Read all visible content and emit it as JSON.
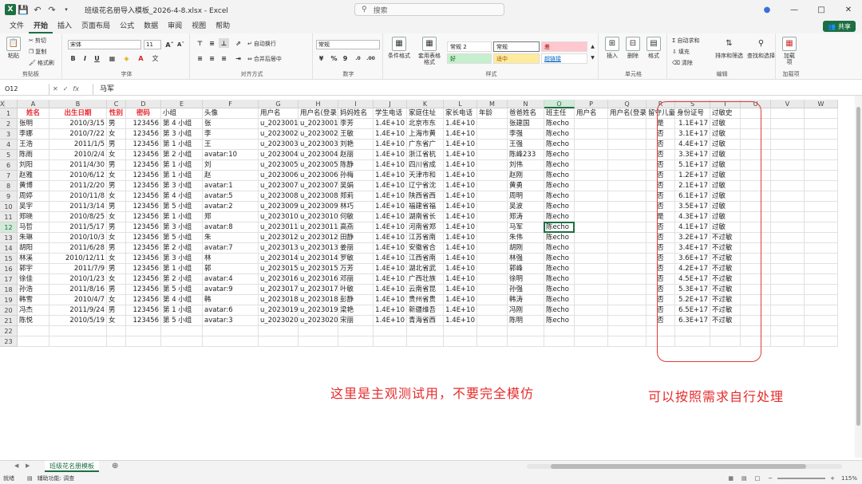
{
  "titlebar": {
    "filename": "班级花名册导入模板_2026-4-8.xlsx",
    "app": "Excel",
    "search_placeholder": "搜索"
  },
  "menu": [
    "文件",
    "开始",
    "插入",
    "页面布局",
    "公式",
    "数据",
    "审阅",
    "视图",
    "帮助"
  ],
  "menu_active": 1,
  "share_label": "共享",
  "ribbon": {
    "clipboard": {
      "paste": "粘贴",
      "cut": "剪切",
      "copy": "复制",
      "format_painter": "格式刷",
      "label": "剪贴板"
    },
    "font": {
      "name": "宋体",
      "size": "11",
      "label": "字体"
    },
    "alignment": {
      "wrap": "自动换行",
      "merge": "合并后居中",
      "label": "对齐方式"
    },
    "number": {
      "format": "常规",
      "label": "数字"
    },
    "styles": {
      "cond_format": "条件格式",
      "table_format": "套用表格格式",
      "normal2": "常规 2",
      "normal": "常规",
      "bad": "差",
      "good": "好",
      "neutral": "适中",
      "hyperlink": "超链接",
      "label": "样式"
    },
    "cells": {
      "insert": "插入",
      "delete": "删除",
      "format": "格式",
      "label": "单元格"
    },
    "editing": {
      "autosum": "自动求和",
      "fill": "填充",
      "clear": "清除",
      "sort": "排序和筛选",
      "find": "查找和选择",
      "label": "编辑"
    },
    "addins": {
      "addin": "加载项",
      "label": "加载项"
    }
  },
  "formula_bar": {
    "name_box": "O12",
    "value": "马军"
  },
  "columns": [
    "A",
    "B",
    "C",
    "D",
    "E",
    "F",
    "G",
    "H",
    "I",
    "J",
    "K",
    "L",
    "M",
    "N",
    "O",
    "P",
    "Q",
    "R",
    "S",
    "T",
    "U",
    "V",
    "W",
    "X"
  ],
  "selected_column": "O",
  "selected_row": 12,
  "row_count": 23,
  "rows": [
    [
      "",
      "姓名",
      "出生日期",
      "性别",
      "密码",
      "小组",
      "头像",
      "用户名",
      "用户名(登录)",
      "妈妈姓名",
      "学生电话",
      "家庭住址",
      "家长电话",
      "年龄",
      "爸爸姓名",
      "班主任",
      "用户名",
      "用户名(登录)",
      "留守儿童",
      "身份证号",
      "过敏史",
      "",
      "",
      ""
    ],
    [
      "",
      "张明",
      "2010/3/15",
      "男",
      "123456",
      "第 4 小组",
      "张",
      "u_2023001",
      "u_2023001",
      "李芳",
      "1.4E+10",
      "北京市东",
      "1.4E+10",
      "",
      "张建国",
      "陈echo",
      "",
      "",
      "是",
      "1.1E+17",
      "过敏",
      "",
      "",
      ""
    ],
    [
      "",
      "李娜",
      "2010/7/22",
      "女",
      "123456",
      "第 3 小组",
      "李",
      "u_2023002",
      "u_2023002",
      "王敏",
      "1.4E+10",
      "上海市黄",
      "1.4E+10",
      "",
      "李强",
      "陈echo",
      "",
      "",
      "否",
      "3.1E+17",
      "过敏",
      "",
      "",
      ""
    ],
    [
      "",
      "王浩",
      "2011/1/5",
      "男",
      "123456",
      "第 1 小组",
      "王",
      "u_2023003",
      "u_2023003",
      "刘艳",
      "1.4E+10",
      "广东省广",
      "1.4E+10",
      "",
      "王强",
      "陈echo",
      "",
      "",
      "否",
      "4.4E+17",
      "过敏",
      "",
      "",
      ""
    ],
    [
      "",
      "陈雨",
      "2010/2/4",
      "女",
      "123456",
      "第 2 小组",
      "avatar:10",
      "u_2023004",
      "u_2023004",
      "赵丽",
      "1.4E+10",
      "浙江省杭",
      "1.4E+10",
      "",
      "陈峰233",
      "陈echo",
      "",
      "",
      "否",
      "3.3E+17",
      "过敏",
      "",
      "",
      ""
    ],
    [
      "",
      "刘阳",
      "2011/4/30",
      "男",
      "123456",
      "第 1 小组",
      "刘",
      "u_2023005",
      "u_2023005",
      "陈静",
      "1.4E+10",
      "四川省成",
      "1.4E+10",
      "",
      "刘伟",
      "陈echo",
      "",
      "",
      "否",
      "5.1E+17",
      "过敏",
      "",
      "",
      ""
    ],
    [
      "",
      "赵雅",
      "2010/6/12",
      "女",
      "123456",
      "第 1 小组",
      "赵",
      "u_2023006",
      "u_2023006",
      "孙梅",
      "1.4E+10",
      "天津市和",
      "1.4E+10",
      "",
      "赵刚",
      "陈echo",
      "",
      "",
      "否",
      "1.2E+17",
      "过敏",
      "",
      "",
      ""
    ],
    [
      "",
      "黄博",
      "2011/2/20",
      "男",
      "123456",
      "第 3 小组",
      "avatar:1",
      "u_2023007",
      "u_2023007",
      "吴娟",
      "1.4E+10",
      "辽宁省沈",
      "1.4E+10",
      "",
      "黄勇",
      "陈echo",
      "",
      "",
      "否",
      "2.1E+17",
      "过敏",
      "",
      "",
      ""
    ],
    [
      "",
      "周婷",
      "2010/11/8",
      "女",
      "123456",
      "第 4 小组",
      "avatar:5",
      "u_2023008",
      "u_2023008",
      "郑莉",
      "1.4E+10",
      "陕西省西",
      "1.4E+10",
      "",
      "周明",
      "陈echo",
      "",
      "",
      "否",
      "6.1E+17",
      "过敏",
      "",
      "",
      ""
    ],
    [
      "",
      "吴宇",
      "2011/3/14",
      "男",
      "123456",
      "第 5 小组",
      "avatar:2",
      "u_2023009",
      "u_2023009",
      "林巧",
      "1.4E+10",
      "福建省福",
      "1.4E+10",
      "",
      "吴波",
      "陈echo",
      "",
      "",
      "否",
      "3.5E+17",
      "过敏",
      "",
      "",
      ""
    ],
    [
      "",
      "郑晓",
      "2010/8/25",
      "女",
      "123456",
      "第 1 小组",
      "郑",
      "u_2023010",
      "u_2023010",
      "何敏",
      "1.4E+10",
      "湖南省长",
      "1.4E+10",
      "",
      "郑涛",
      "陈echo",
      "",
      "",
      "是",
      "4.3E+17",
      "过敏",
      "",
      "",
      ""
    ],
    [
      "",
      "马哲",
      "2011/5/17",
      "男",
      "123456",
      "第 3 小组",
      "avatar:8",
      "u_2023011",
      "u_2023011",
      "高燕",
      "1.4E+10",
      "河南省郑",
      "1.4E+10",
      "",
      "马军",
      "陈echo",
      "",
      "",
      "否",
      "4.1E+17",
      "过敏",
      "",
      "",
      ""
    ],
    [
      "",
      "朱琳",
      "2010/10/3",
      "女",
      "123456",
      "第 5 小组",
      "朱",
      "u_2023012",
      "u_2023012",
      "田静",
      "1.4E+10",
      "江苏省南",
      "1.4E+10",
      "",
      "朱伟",
      "陈echo",
      "",
      "",
      "否",
      "3.2E+17",
      "不过敏",
      "",
      "",
      ""
    ],
    [
      "",
      "胡阳",
      "2011/6/28",
      "男",
      "123456",
      "第 2 小组",
      "avatar:7",
      "u_2023013",
      "u_2023013",
      "姜丽",
      "1.4E+10",
      "安徽省合",
      "1.4E+10",
      "",
      "胡刚",
      "陈echo",
      "",
      "",
      "否",
      "3.4E+17",
      "不过敏",
      "",
      "",
      ""
    ],
    [
      "",
      "林溪",
      "2010/12/11",
      "女",
      "123456",
      "第 3 小组",
      "林",
      "u_2023014",
      "u_2023014",
      "罗敏",
      "1.4E+10",
      "江西省南",
      "1.4E+10",
      "",
      "林强",
      "陈echo",
      "",
      "",
      "否",
      "3.6E+17",
      "不过敏",
      "",
      "",
      ""
    ],
    [
      "",
      "郭宇",
      "2011/7/9",
      "男",
      "123456",
      "第 1 小组",
      "郭",
      "u_2023015",
      "u_2023015",
      "万芳",
      "1.4E+10",
      "湖北省武",
      "1.4E+10",
      "",
      "郭峰",
      "陈echo",
      "",
      "",
      "否",
      "4.2E+17",
      "不过敏",
      "",
      "",
      ""
    ],
    [
      "",
      "徐佳",
      "2010/1/23",
      "女",
      "123456",
      "第 2 小组",
      "avatar:4",
      "u_2023016",
      "u_2023016",
      "邓丽",
      "1.4E+10",
      "广西壮族",
      "1.4E+10",
      "",
      "徐明",
      "陈echo",
      "",
      "",
      "否",
      "4.5E+17",
      "不过敏",
      "",
      "",
      ""
    ],
    [
      "",
      "孙浩",
      "2011/8/16",
      "男",
      "123456",
      "第 5 小组",
      "avatar:9",
      "u_2023017",
      "u_2023017",
      "叶敏",
      "1.4E+10",
      "云南省昆",
      "1.4E+10",
      "",
      "孙强",
      "陈echo",
      "",
      "",
      "否",
      "5.3E+17",
      "不过敏",
      "",
      "",
      ""
    ],
    [
      "",
      "韩雪",
      "2010/4/7",
      "女",
      "123456",
      "第 4 小组",
      "韩",
      "u_2023018",
      "u_2023018",
      "彭静",
      "1.4E+10",
      "贵州省贵",
      "1.4E+10",
      "",
      "韩涛",
      "陈echo",
      "",
      "",
      "否",
      "5.2E+17",
      "不过敏",
      "",
      "",
      ""
    ],
    [
      "",
      "冯杰",
      "2011/9/24",
      "男",
      "123456",
      "第 1 小组",
      "avatar:6",
      "u_2023019",
      "u_2023019",
      "梁艳",
      "1.4E+10",
      "新疆维吾",
      "1.4E+10",
      "",
      "冯刚",
      "陈echo",
      "",
      "",
      "否",
      "6.5E+17",
      "不过敏",
      "",
      "",
      ""
    ],
    [
      "",
      "陈悦",
      "2010/5/19",
      "女",
      "123456",
      "第 5 小组",
      "avatar:3",
      "u_2023020",
      "u_2023020",
      "宋丽",
      "1.4E+10",
      "青海省西",
      "1.4E+10",
      "",
      "陈明",
      "陈echo",
      "",
      "",
      "否",
      "6.3E+17",
      "不过敏",
      "",
      "",
      ""
    ]
  ],
  "annotations": {
    "left": "这里是主观测试用，不要完全模仿",
    "right": "可以按照需求自行处理"
  },
  "sheet_tab": "班级花名册模板",
  "status": {
    "ready": "就绪",
    "accessibility": "辅助功能: 调查",
    "zoom": "115%"
  },
  "colors": {
    "excel_green": "#1d6f42",
    "header_red": "#e8262c",
    "annotation_red": "#e62b2b"
  }
}
